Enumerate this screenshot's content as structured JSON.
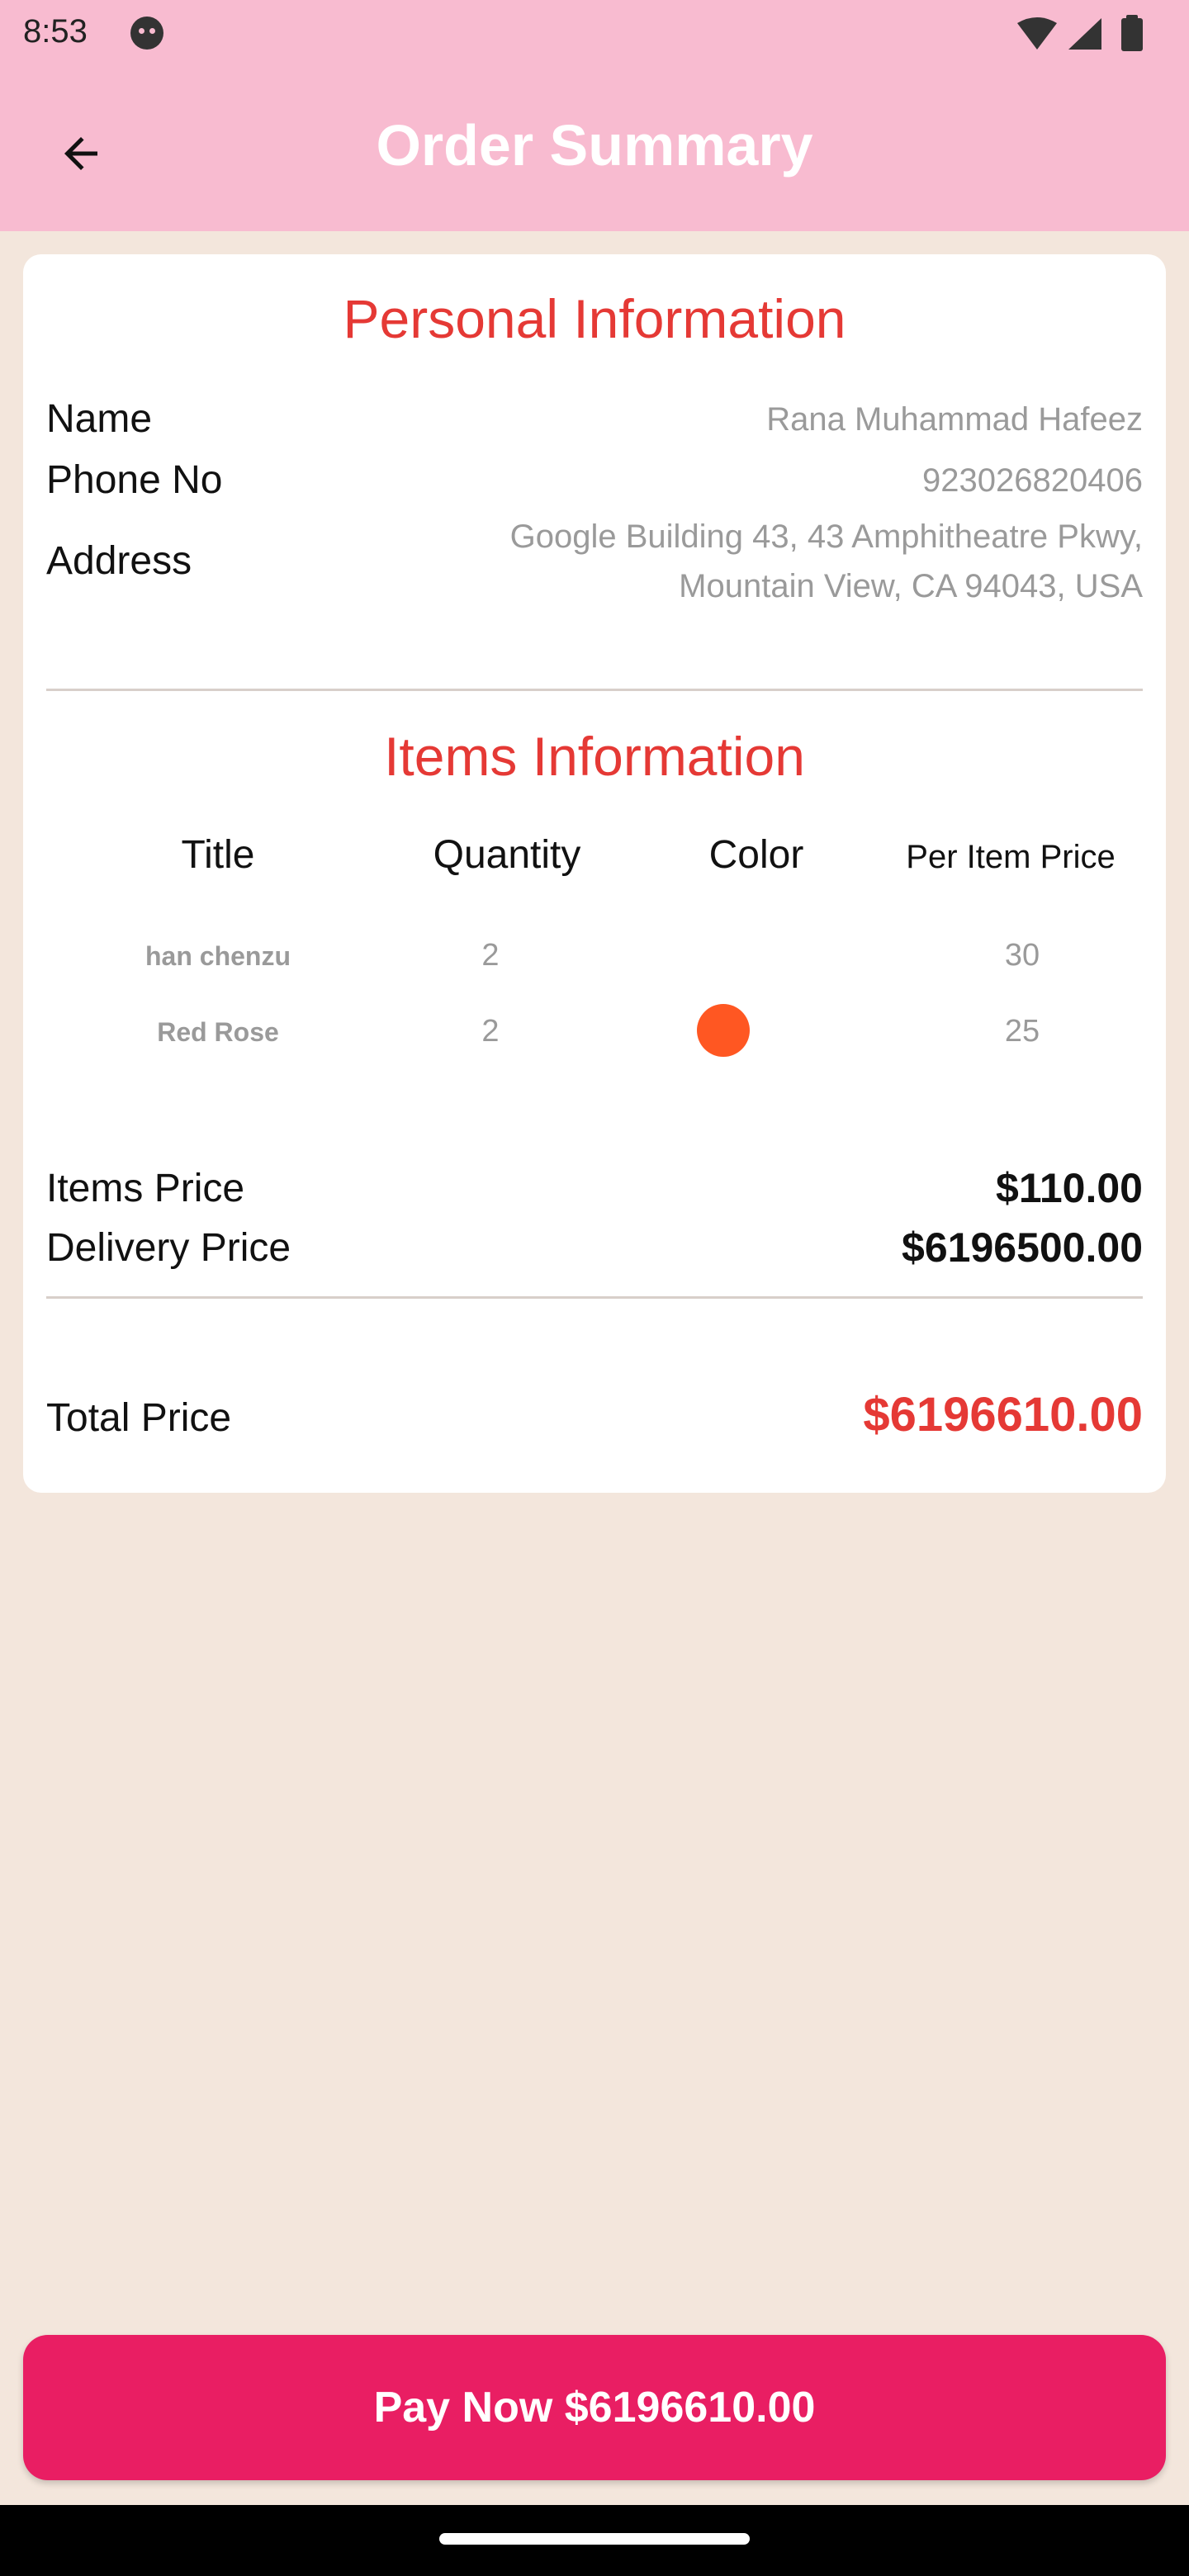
{
  "status_bar": {
    "time": "8:53"
  },
  "app_bar": {
    "title": "Order Summary"
  },
  "personal": {
    "heading": "Personal Information",
    "name_label": "Name",
    "name_value": "Rana Muhammad Hafeez",
    "phone_label": "Phone No",
    "phone_value": "923026820406",
    "address_label": "Address",
    "address_line1": "Google Building 43, 43 Amphitheatre Pkwy,",
    "address_line2": "Mountain View, CA 94043, USA"
  },
  "items": {
    "heading": "Items Information",
    "columns": [
      "Title",
      "Quantity",
      "Color",
      "Per Item Price"
    ],
    "rows": [
      {
        "title": "han chenzu",
        "quantity": "2",
        "color": "",
        "price": "30"
      },
      {
        "title": "Red Rose",
        "quantity": "2",
        "color": "#ff5722",
        "price": "25"
      }
    ]
  },
  "pricing": {
    "items_label": "Items Price",
    "items_value": "$110.00",
    "delivery_label": "Delivery Price",
    "delivery_value": "$6196500.00",
    "total_label": "Total Price",
    "total_value": "$6196610.00"
  },
  "pay_button": {
    "label": "Pay Now $6196610.00"
  },
  "colors": {
    "app_bar": "#f8bbd0",
    "background": "#f3e6dc",
    "accent_red": "#e53935",
    "pay_button": "#e91e63"
  },
  "icons": [
    "back-arrow-icon",
    "notification-face-icon",
    "wifi-icon",
    "signal-icon",
    "battery-icon"
  ]
}
